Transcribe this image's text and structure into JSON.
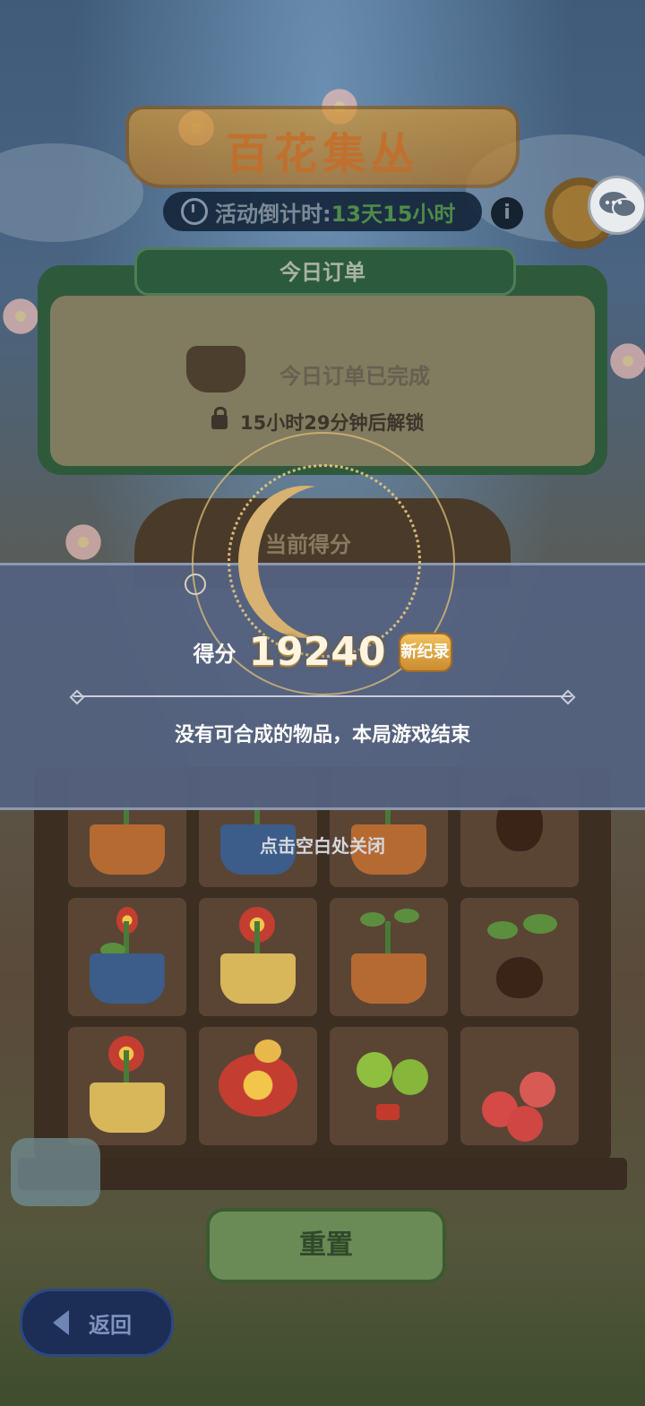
{
  "title": "百花集丛",
  "timer": {
    "label": "活动倒计时:",
    "value": "13天15小时"
  },
  "info_icon": "i",
  "order": {
    "tab_label": "今日订单",
    "done_text": "今日订单已完成",
    "unlock_text": "15小时29分钟后解锁"
  },
  "board": {
    "label": "当前得分"
  },
  "result": {
    "score_label": "得分",
    "score_value": "19240",
    "record_badge": "新纪录",
    "end_message": "没有可合成的物品，本局游戏结束",
    "close_hint": "点击空白处关闭"
  },
  "buttons": {
    "reset": "重置",
    "back": "返回"
  },
  "colors": {
    "overlay": "#546281",
    "score_gold": "#d7b270",
    "timer_value": "#4e8c40"
  },
  "grid_items": [
    [
      "terracotta-pot-sprout",
      "blue-pot-sprout",
      "terracotta-pot-sprout",
      "seed"
    ],
    [
      "blue-pot-red-bud",
      "patterned-pot-red-flower",
      "patterned-pot-sprout",
      "bulb-sprout"
    ],
    [
      "patterned-pot-red-flower",
      "red-flower-with-bee",
      "green-tomato-plant",
      "red-tomato-plant"
    ]
  ]
}
